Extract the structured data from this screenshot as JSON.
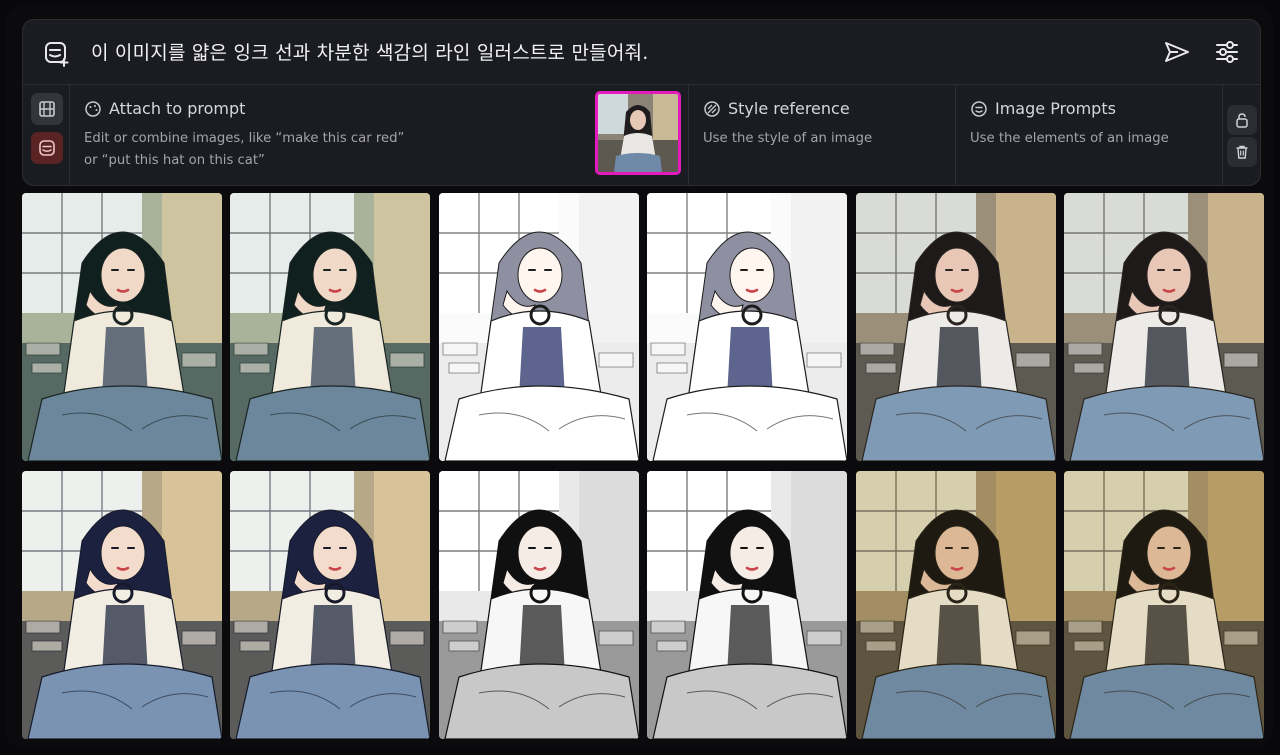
{
  "prompt": {
    "text": "이 이미지를 얇은 잉크 선과 차분한 색감의 라인 일러스트로 만들어줘."
  },
  "sections": {
    "attach": {
      "title": "Attach to prompt",
      "desc_line1": "Edit or combine images, like “make this car red”",
      "desc_line2": "or “put this hat on this cat”"
    },
    "style": {
      "title": "Style reference",
      "desc": "Use the style of an image"
    },
    "image_prompts": {
      "title": "Image Prompts",
      "desc": "Use the elements of an image"
    }
  },
  "colors": {
    "accent_highlight": "#e31bbd",
    "panel_bg": "#1b1c21",
    "page_bg": "#08080a"
  },
  "grid": {
    "rows": 2,
    "columns": 6,
    "styles": [
      "anime-green",
      "anime-green",
      "line-art",
      "line-art",
      "photo-warm",
      "photo-warm",
      "anime-navy",
      "anime-navy",
      "ink-sketch",
      "ink-sketch",
      "photo-sepia",
      "photo-sepia"
    ]
  }
}
